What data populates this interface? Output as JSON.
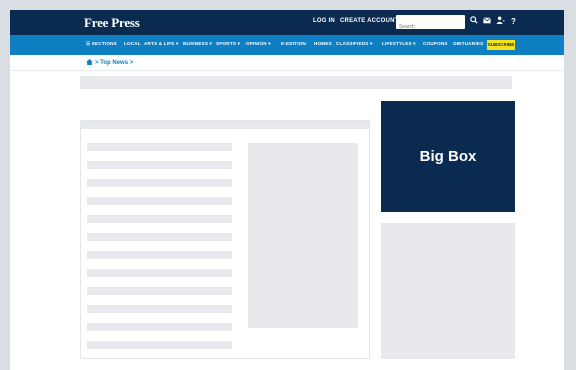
{
  "header": {
    "logo": "Free Press",
    "login": "LOG IN",
    "create_account": "CREATE ACCOUNT",
    "search_placeholder": "Search",
    "icons": [
      "search-icon",
      "mail-icon",
      "user-icon",
      "help-icon"
    ]
  },
  "nav": {
    "items": [
      "☰ SECTIONS",
      "LOCAL",
      "ARTS & LIFE ▾",
      "BUSINESS ▾",
      "SPORTS ▾",
      "OPINION ▾",
      "E-EDITION",
      "HOMES",
      "CLASSIFIEDS ▾",
      "LIFESTYLES ▾",
      "COUPONS",
      "OBITUARIES"
    ],
    "subscribe": "SUBSCRIBE"
  },
  "breadcrumb": {
    "home_icon": "home-icon",
    "text": "> Top News >"
  },
  "ad": {
    "label": "Big Box"
  },
  "colors": {
    "header_bg": "#0b2a4f",
    "nav_bg": "#0f7fc4",
    "subscribe_bg": "#f6e11a",
    "placeholder": "#e7e9ec"
  }
}
